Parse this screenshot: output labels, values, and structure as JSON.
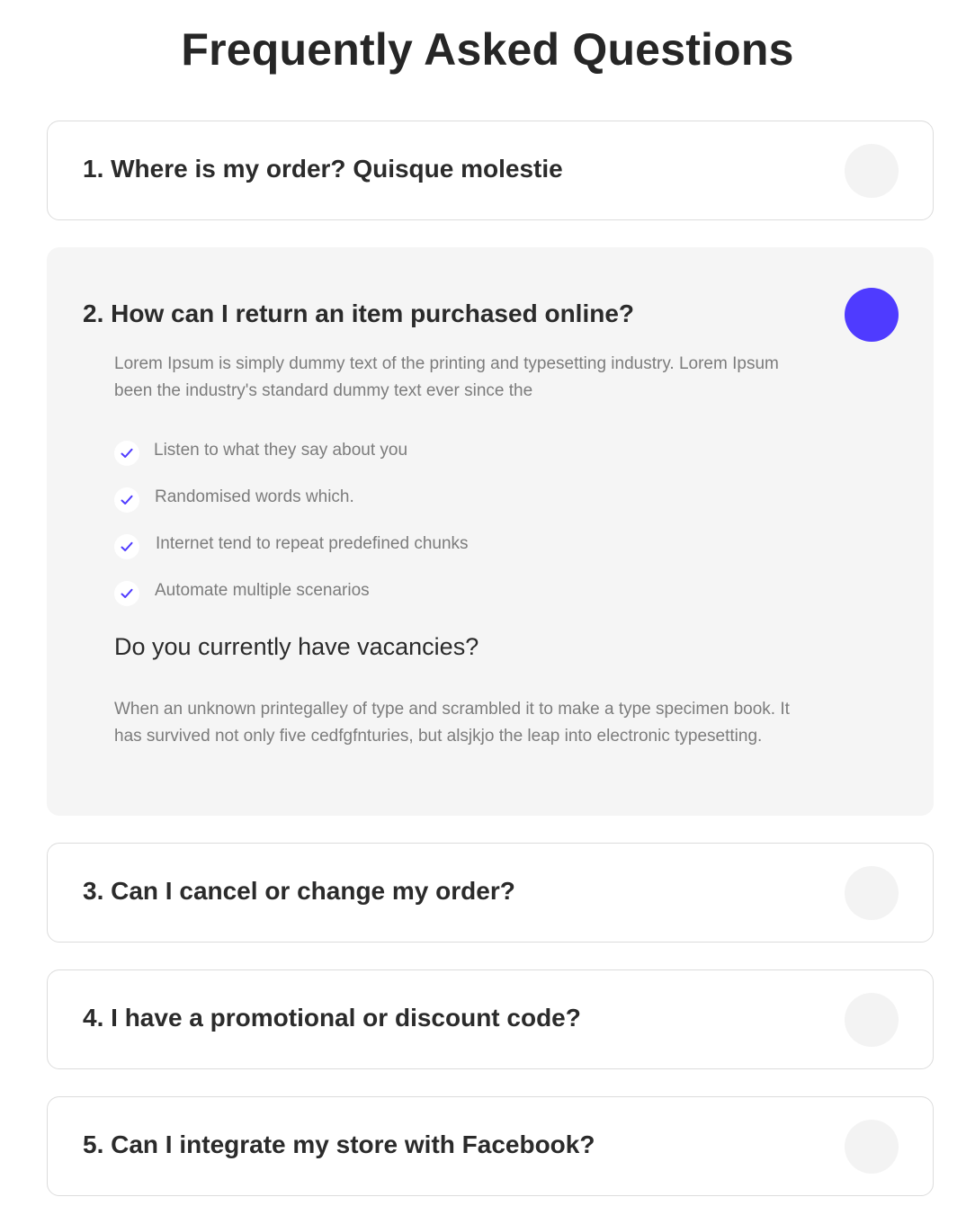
{
  "page_title": "Frequently Asked Questions",
  "faq": [
    {
      "question": "1. Where is my order? Quisque molestie",
      "expanded": false
    },
    {
      "question": "2. How can I return an item purchased online?",
      "expanded": true,
      "answer": "Lorem Ipsum is simply dummy text of the printing and typesetting industry. Lorem Ipsum been the industry's standard dummy text ever since the",
      "checklist": [
        "Listen to what they say about you",
        "Randomised words which.",
        "Internet tend to repeat predefined chunks",
        "Automate multiple scenarios"
      ],
      "sub_heading": "Do you currently have vacancies?",
      "sub_answer": "When an unknown printegalley of type and scrambled it to make a type specimen book. It has survived not only five cedfgfnturies, but alsjkjo the leap into electronic typesetting."
    },
    {
      "question": "3. Can I cancel or change my order?",
      "expanded": false
    },
    {
      "question": "4. I have a promotional or discount code?",
      "expanded": false
    },
    {
      "question": "5. Can I integrate my store with Facebook?",
      "expanded": false
    }
  ],
  "colors": {
    "accent": "#4f3bff",
    "toggle_idle": "#f3f3f3",
    "open_panel": "#f5f5f5",
    "border": "#dcdcdc",
    "body_text": "#7c7c7c",
    "heading_text": "#2b2b2b"
  },
  "icons": {
    "check": "check-icon"
  }
}
